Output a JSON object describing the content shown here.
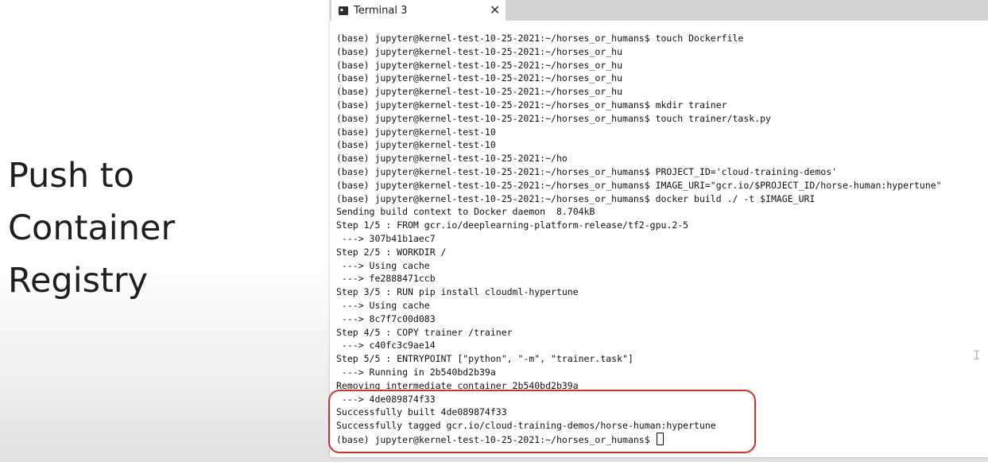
{
  "slide": {
    "title_lines": [
      "Push to",
      "Container",
      "Registry"
    ]
  },
  "terminal": {
    "tab_title": "Terminal 3",
    "close_glyph": "✕",
    "lines": [
      "(base) jupyter@kernel-test-10-25-2021:~/horses_or_humans$ touch Dockerfile",
      "(base) jupyter@kernel-test-10-25-2021:~/horses_or_hu",
      "(base) jupyter@kernel-test-10-25-2021:~/horses_or_hu",
      "(base) jupyter@kernel-test-10-25-2021:~/horses_or_hu",
      "(base) jupyter@kernel-test-10-25-2021:~/horses_or_hu",
      "(base) jupyter@kernel-test-10-25-2021:~/horses_or_humans$ mkdir trainer",
      "(base) jupyter@kernel-test-10-25-2021:~/horses_or_humans$ touch trainer/task.py",
      "(base) jupyter@kernel-test-10",
      "(base) jupyter@kernel-test-10",
      "(base) jupyter@kernel-test-10-25-2021:~/ho",
      "(base) jupyter@kernel-test-10-25-2021:~/horses_or_humans$ PROJECT_ID='cloud-training-demos'",
      "(base) jupyter@kernel-test-10-25-2021:~/horses_or_humans$ IMAGE_URI=\"gcr.io/$PROJECT_ID/horse-human:hypertune\"",
      "(base) jupyter@kernel-test-10-25-2021:~/horses_or_humans$ docker build ./ -t $IMAGE_URI",
      "Sending build context to Docker daemon  8.704kB",
      "Step 1/5 : FROM gcr.io/deeplearning-platform-release/tf2-gpu.2-5",
      " ---> 307b41b1aec7",
      "Step 2/5 : WORKDIR /",
      " ---> Using cache",
      " ---> fe2888471ccb",
      "Step 3/5 : RUN pip install cloudml-hypertune",
      " ---> Using cache",
      " ---> 8c7f7c00d083",
      "Step 4/5 : COPY trainer /trainer",
      " ---> c40fc3c9ae14",
      "Step 5/5 : ENTRYPOINT [\"python\", \"-m\", \"trainer.task\"]",
      " ---> Running in 2b540bd2b39a",
      "Removing intermediate container 2b540bd2b39a",
      " ---> 4de089874f33",
      "Successfully built 4de089874f33",
      "Successfully tagged gcr.io/cloud-training-demos/horse-human:hypertune"
    ],
    "prompt": "(base) jupyter@kernel-test-10-25-2021:~/horses_or_humans$ ",
    "text_caret_glyph": "I"
  },
  "colors": {
    "highlight_border": "#c9342f",
    "tabbar_background": "#d2d2d2",
    "terminal_text": "#111111"
  },
  "icons": {
    "terminal_tab": "terminal-icon",
    "tab_close": "close-icon",
    "text_caret": "text-cursor-icon"
  }
}
